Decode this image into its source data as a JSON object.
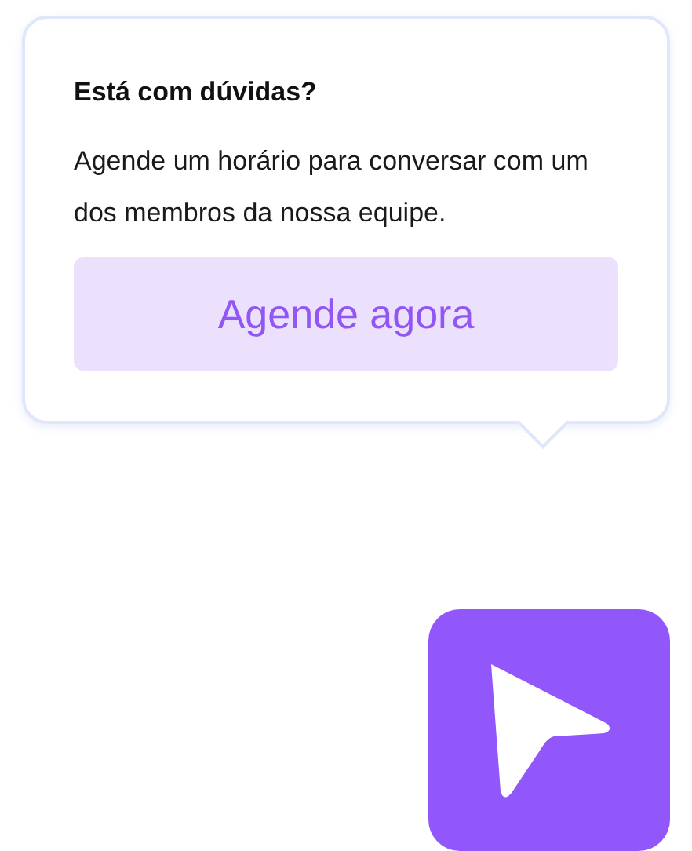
{
  "popover": {
    "title": "Está com dúvidas?",
    "body": "Agende um horário para conversar com um dos membros da nossa equipe.",
    "button": "Agende agora"
  }
}
